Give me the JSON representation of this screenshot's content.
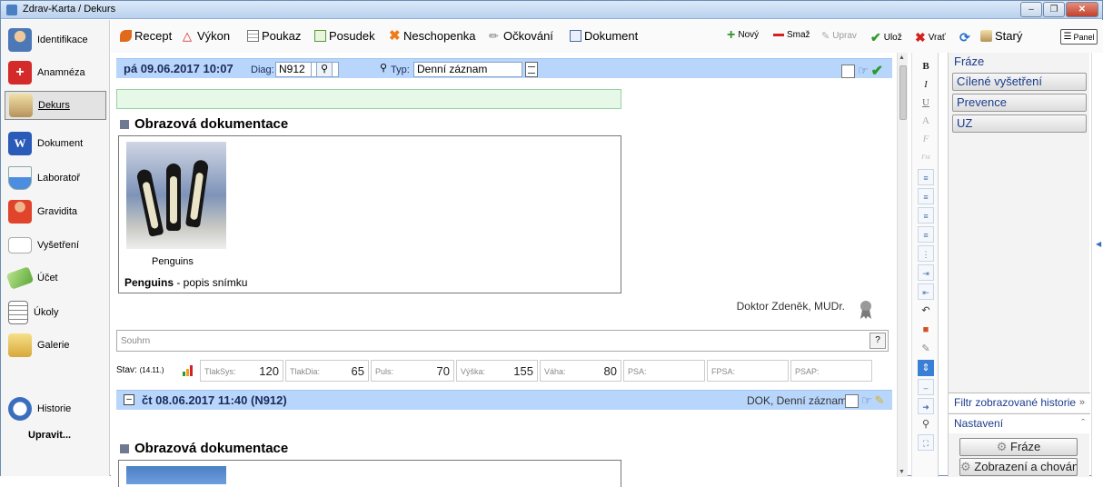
{
  "window": {
    "title": "Zdrav-Karta / Dekurs"
  },
  "nav": {
    "items": [
      {
        "label": "Identifikace",
        "icon": "person-icon"
      },
      {
        "label": "Anamnéza",
        "icon": "medical-cross-icon"
      },
      {
        "label": "Dekurs",
        "icon": "folder-icon"
      },
      {
        "label": "Dokument",
        "icon": "word-document-icon"
      },
      {
        "label": "Laboratoř",
        "icon": "flask-icon"
      },
      {
        "label": "Gravidita",
        "icon": "pregnancy-icon"
      },
      {
        "label": "Vyšetření",
        "icon": "ecg-icon"
      },
      {
        "label": "Účet",
        "icon": "money-icon"
      },
      {
        "label": "Úkoly",
        "icon": "notepad-icon"
      },
      {
        "label": "Galerie",
        "icon": "gallery-folder-icon"
      },
      {
        "label": "Historie",
        "icon": "history-clock-icon"
      }
    ],
    "edit_label": "Upravit..."
  },
  "toolbar": {
    "recept": "Recept",
    "vykon": "Výkon",
    "poukaz": "Poukaz",
    "posudek": "Posudek",
    "neschopenka": "Neschopenka",
    "ockovani": "Očkování",
    "dokument": "Dokument",
    "novy": "Nový",
    "smaz": "Smaž",
    "uprav": "Uprav",
    "uloz": "Ulož",
    "vrat": "Vrať",
    "stary": "Starý",
    "panel": "Panel"
  },
  "record1": {
    "date": "pá 09.06.2017 10:07",
    "diag_label": "Diag:",
    "diag_value": "N912",
    "typ_label": "Typ:",
    "typ_value": "Denní záznam",
    "section_title": "Obrazová dokumentace",
    "image_caption": "Penguins",
    "image_desc_bold": "Penguins",
    "image_desc_rest": " - popis snímku",
    "doctor": "Doktor Zdeněk, MUDr.",
    "summary_placeholder": "Souhrn",
    "summary_help": "?"
  },
  "vitals": {
    "stav_label": "Stav:",
    "stav_date": "(14.11.)",
    "fields": [
      {
        "label": "TlakSys:",
        "value": "120"
      },
      {
        "label": "TlakDia:",
        "value": "65"
      },
      {
        "label": "Puls:",
        "value": "70"
      },
      {
        "label": "Výška:",
        "value": "155"
      },
      {
        "label": "Váha:",
        "value": "80"
      },
      {
        "label": "PSA:",
        "value": ""
      },
      {
        "label": "FPSA:",
        "value": ""
      },
      {
        "label": "PSAP:",
        "value": ""
      }
    ]
  },
  "record2": {
    "title": "čt 08.06.2017 11:40 (N912)",
    "right_text": "DOK, Denní záznam",
    "section_title": "Obrazová dokumentace"
  },
  "format": {
    "bold": "B",
    "italic": "I",
    "underline": "U",
    "font": "A",
    "f": "F",
    "fnt": "Fnt"
  },
  "right_panel": {
    "header": "Fráze",
    "items": [
      "Cílené vyšetření",
      "Prevence",
      "UZ"
    ],
    "filter": "Filtr zobrazované historie",
    "settings": "Nastavení",
    "btn_fraze": "Fráze",
    "btn_zobrazeni": "Zobrazení a chování"
  },
  "colors": {
    "record_header": "#b8d6fb",
    "green_bar": "#e6f8e8",
    "title_bar": "#dce9f7"
  }
}
